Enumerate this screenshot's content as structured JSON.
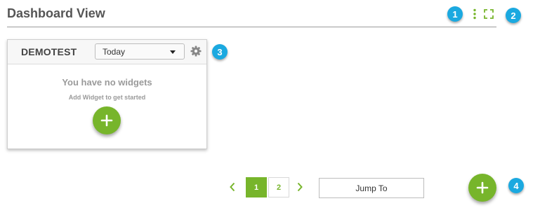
{
  "header": {
    "title": "Dashboard View",
    "more_icon": "vertical-ellipsis-icon",
    "fullscreen_icon": "expand-icon"
  },
  "callouts": [
    "1",
    "2",
    "3",
    "4"
  ],
  "widget": {
    "title": "DEMOTEST",
    "range_value": "Today",
    "settings_icon": "gear-icon",
    "empty_title": "You have no widgets",
    "empty_subtitle": "Add Widget to get started",
    "add_icon": "plus-icon"
  },
  "pagination": {
    "pages": [
      "1",
      "2"
    ],
    "current": "1",
    "jump_label": "Jump To"
  },
  "colors": {
    "accent_green": "#77b52b",
    "callout_blue": "#1ba9e0"
  }
}
